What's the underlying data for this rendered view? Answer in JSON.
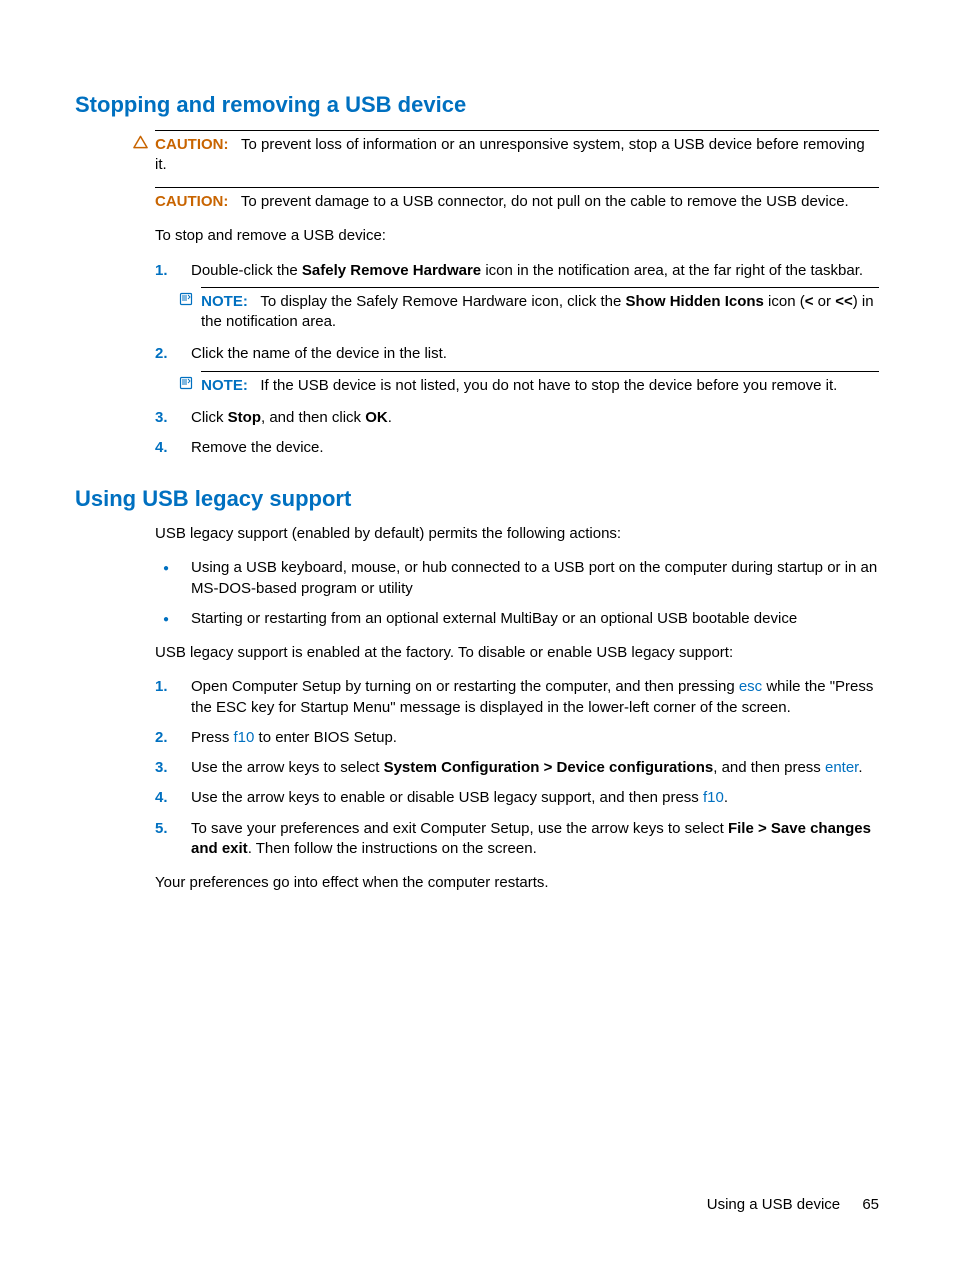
{
  "section1": {
    "heading": "Stopping and removing a USB device",
    "caution1_label": "CAUTION:",
    "caution1_text": "To prevent loss of information or an unresponsive system, stop a USB device before removing it.",
    "caution2_label": "CAUTION:",
    "caution2_text": "To prevent damage to a USB connector, do not pull on the cable to remove the USB device.",
    "intro": "To stop and remove a USB device:",
    "step1_a": "Double-click the ",
    "step1_bold": "Safely Remove Hardware",
    "step1_b": " icon in the notification area, at the far right of the taskbar.",
    "note1_label": "NOTE:",
    "note1_a": "To display the Safely Remove Hardware icon, click the ",
    "note1_bold1": "Show Hidden Icons",
    "note1_b": " icon (",
    "note1_bold2": "<",
    "note1_c": " or ",
    "note1_bold3": "<<",
    "note1_d": ") in the notification area.",
    "step2": "Click the name of the device in the list.",
    "note2_label": "NOTE:",
    "note2_text": "If the USB device is not listed, you do not have to stop the device before you remove it.",
    "step3_a": "Click ",
    "step3_bold1": "Stop",
    "step3_b": ", and then click ",
    "step3_bold2": "OK",
    "step3_c": ".",
    "step4": "Remove the device."
  },
  "section2": {
    "heading": "Using USB legacy support",
    "intro": "USB legacy support (enabled by default) permits the following actions:",
    "bullet1": "Using a USB keyboard, mouse, or hub connected to a USB port on the computer during startup or in an MS-DOS-based program or utility",
    "bullet2": "Starting or restarting from an optional external MultiBay or an optional USB bootable device",
    "mid": "USB legacy support is enabled at the factory. To disable or enable USB legacy support:",
    "step1_a": "Open Computer Setup by turning on or restarting the computer, and then pressing ",
    "step1_key": "esc",
    "step1_b": " while the \"Press the ESC key for Startup Menu\" message is displayed in the lower-left corner of the screen.",
    "step2_a": "Press ",
    "step2_key": "f10",
    "step2_b": " to enter BIOS Setup.",
    "step3_a": "Use the arrow keys to select ",
    "step3_bold": "System Configuration > Device configurations",
    "step3_b": ", and then press ",
    "step3_key": "enter",
    "step3_c": ".",
    "step4_a": "Use the arrow keys to enable or disable USB legacy support, and then press ",
    "step4_key": "f10",
    "step4_b": ".",
    "step5_a": "To save your preferences and exit Computer Setup, use the arrow keys to select ",
    "step5_bold": "File > Save changes and exit",
    "step5_b": ". Then follow the instructions on the screen.",
    "outro": "Your preferences go into effect when the computer restarts."
  },
  "footer": {
    "title": "Using a USB device",
    "page": "65"
  }
}
